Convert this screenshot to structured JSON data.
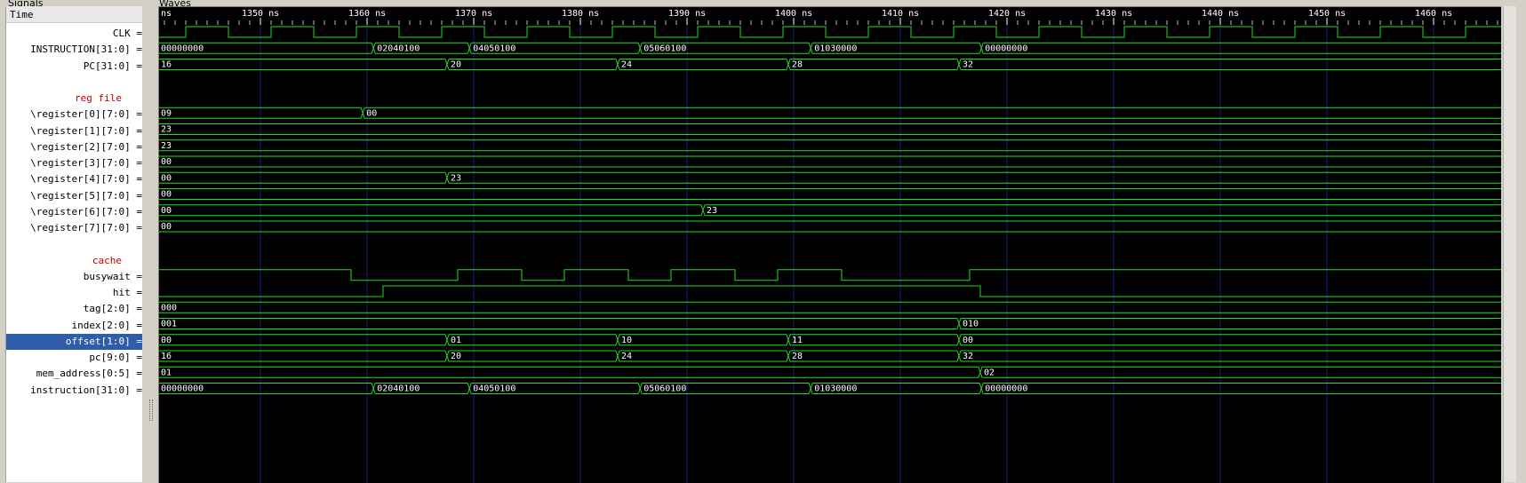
{
  "panels": {
    "signals_title": "Signals",
    "waves_title": "Waves"
  },
  "time_label": "Time",
  "time_axis": {
    "start_label": "ns",
    "ticks": [
      {
        "t": 1350,
        "label": "1350 ns"
      },
      {
        "t": 1360,
        "label": "1360 ns"
      },
      {
        "t": 1370,
        "label": "1370 ns"
      },
      {
        "t": 1380,
        "label": "1380 ns"
      },
      {
        "t": 1390,
        "label": "1390 ns"
      },
      {
        "t": 1400,
        "label": "1400 ns"
      },
      {
        "t": 1410,
        "label": "1410 ns"
      },
      {
        "t": 1420,
        "label": "1420 ns"
      },
      {
        "t": 1430,
        "label": "1430 ns"
      },
      {
        "t": 1440,
        "label": "1440 ns"
      },
      {
        "t": 1450,
        "label": "1450 ns"
      },
      {
        "t": 1460,
        "label": "1460 ns"
      }
    ]
  },
  "colors": {
    "wave": "#22dd22",
    "grid": "#1c1c7c",
    "text": "#ffffff",
    "group_label": "#c00000",
    "selected": "#2f5da8"
  },
  "signals": [
    {
      "label": "CLK =",
      "type": "clock",
      "period": 8,
      "high_at_start": false,
      "first_edge": 1343
    },
    {
      "label": "INSTRUCTION[31:0] =",
      "type": "bus",
      "segments": [
        {
          "t": 1339.3,
          "v": "00000000"
        },
        {
          "t": 1360.6,
          "v": "02040100"
        },
        {
          "t": 1369.6,
          "v": "04050100"
        },
        {
          "t": 1385.6,
          "v": "05060100"
        },
        {
          "t": 1401.6,
          "v": "01030000"
        },
        {
          "t": 1417.6,
          "v": "00000000"
        }
      ]
    },
    {
      "label": "PC[31:0] =",
      "type": "bus",
      "segments": [
        {
          "t": 1339.3,
          "v": "16"
        },
        {
          "t": 1367.5,
          "v": "20"
        },
        {
          "t": 1383.5,
          "v": "24"
        },
        {
          "t": 1399.5,
          "v": "28"
        },
        {
          "t": 1415.5,
          "v": "32"
        }
      ]
    },
    {
      "label": "",
      "type": "blank"
    },
    {
      "label": "reg file",
      "type": "group"
    },
    {
      "label": "\\register[0][7:0] =",
      "type": "bus",
      "segments": [
        {
          "t": 1339.3,
          "v": "09"
        },
        {
          "t": 1359.6,
          "v": "00"
        }
      ]
    },
    {
      "label": "\\register[1][7:0] =",
      "type": "bus",
      "segments": [
        {
          "t": 1339.3,
          "v": "23"
        }
      ]
    },
    {
      "label": "\\register[2][7:0] =",
      "type": "bus",
      "segments": [
        {
          "t": 1339.3,
          "v": "23"
        }
      ]
    },
    {
      "label": "\\register[3][7:0] =",
      "type": "bus",
      "segments": [
        {
          "t": 1339.3,
          "v": "00"
        }
      ]
    },
    {
      "label": "\\register[4][7:0] =",
      "type": "bus",
      "segments": [
        {
          "t": 1339.3,
          "v": "00"
        },
        {
          "t": 1367.5,
          "v": "23"
        }
      ]
    },
    {
      "label": "\\register[5][7:0] =",
      "type": "bus",
      "segments": [
        {
          "t": 1339.3,
          "v": "00"
        }
      ]
    },
    {
      "label": "\\register[6][7:0] =",
      "type": "bus",
      "segments": [
        {
          "t": 1339.3,
          "v": "00"
        },
        {
          "t": 1391.5,
          "v": "23"
        }
      ]
    },
    {
      "label": "\\register[7][7:0] =",
      "type": "bus",
      "segments": [
        {
          "t": 1339.3,
          "v": "00"
        }
      ]
    },
    {
      "label": "",
      "type": "blank"
    },
    {
      "label": "cache",
      "type": "group"
    },
    {
      "label": "busywait =",
      "type": "bit",
      "start": 1,
      "edges": [
        1358.5,
        1368.5,
        1374.5,
        1378.5,
        1384.5,
        1388.5,
        1394.5,
        1398.5,
        1404.5,
        1416.5
      ]
    },
    {
      "label": "hit =",
      "type": "bit",
      "start": 0,
      "edges": [
        1361.5,
        1417.5
      ]
    },
    {
      "label": "tag[2:0] =",
      "type": "bus",
      "segments": [
        {
          "t": 1339.3,
          "v": "000"
        }
      ]
    },
    {
      "label": "index[2:0] =",
      "type": "bus",
      "segments": [
        {
          "t": 1339.3,
          "v": "001"
        },
        {
          "t": 1415.5,
          "v": "010"
        }
      ]
    },
    {
      "label": "offset[1:0] =",
      "type": "bus",
      "selected": true,
      "segments": [
        {
          "t": 1339.3,
          "v": "00"
        },
        {
          "t": 1367.5,
          "v": "01"
        },
        {
          "t": 1383.5,
          "v": "10"
        },
        {
          "t": 1399.5,
          "v": "11"
        },
        {
          "t": 1415.5,
          "v": "00"
        }
      ]
    },
    {
      "label": "pc[9:0] =",
      "type": "bus",
      "segments": [
        {
          "t": 1339.3,
          "v": "16"
        },
        {
          "t": 1367.5,
          "v": "20"
        },
        {
          "t": 1383.5,
          "v": "24"
        },
        {
          "t": 1399.5,
          "v": "28"
        },
        {
          "t": 1415.5,
          "v": "32"
        }
      ]
    },
    {
      "label": "mem_address[0:5] =",
      "type": "bus",
      "segments": [
        {
          "t": 1339.3,
          "v": "01"
        },
        {
          "t": 1417.5,
          "v": "02"
        }
      ]
    },
    {
      "label": "instruction[31:0] =",
      "type": "bus",
      "segments": [
        {
          "t": 1339.3,
          "v": "00000000"
        },
        {
          "t": 1360.6,
          "v": "02040100"
        },
        {
          "t": 1369.6,
          "v": "04050100"
        },
        {
          "t": 1385.6,
          "v": "05060100"
        },
        {
          "t": 1401.6,
          "v": "01030000"
        },
        {
          "t": 1417.6,
          "v": "00000000"
        }
      ]
    }
  ]
}
